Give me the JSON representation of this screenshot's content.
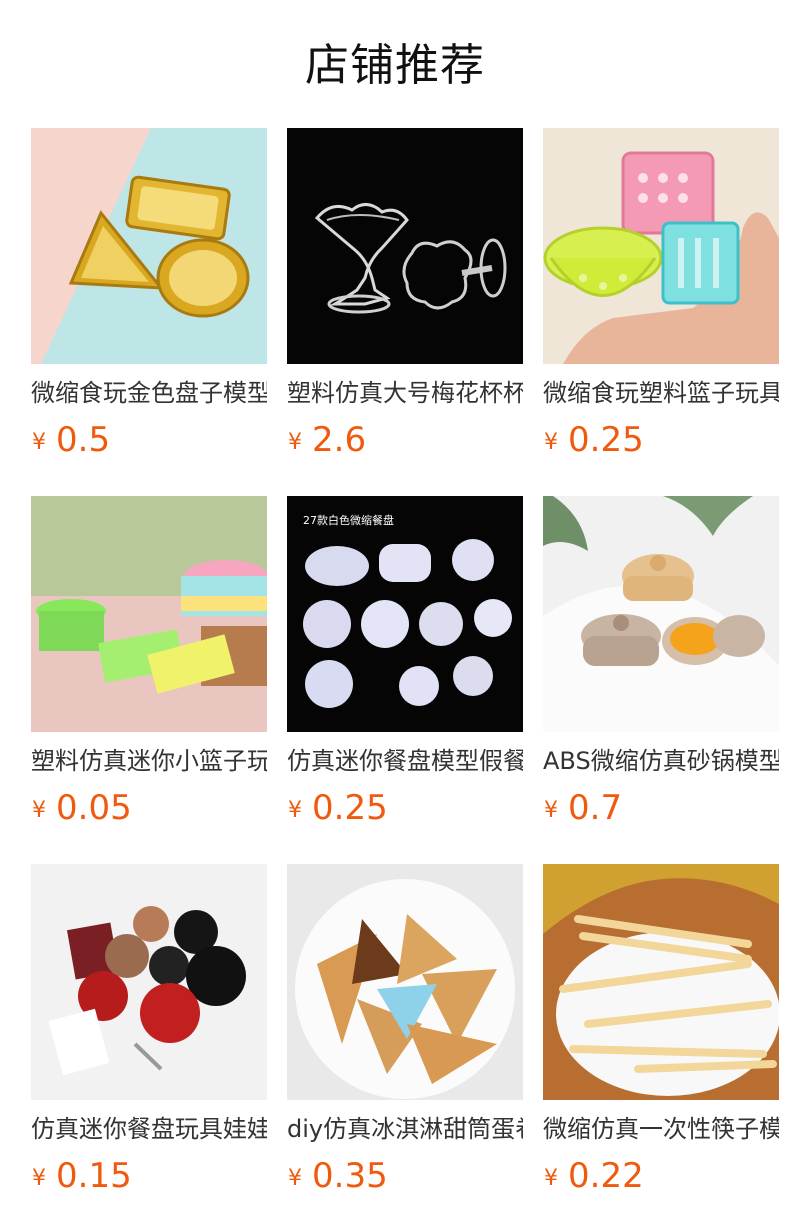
{
  "section": {
    "title": "店铺推荐"
  },
  "products": [
    {
      "name": "微缩食玩金色盘子模型",
      "currency": "¥",
      "price": "0.5",
      "image": "gold-plates-image"
    },
    {
      "name": "塑料仿真大号梅花杯杯",
      "currency": "¥",
      "price": "2.6",
      "image": "plastic-cup-image"
    },
    {
      "name": "微缩食玩塑料篮子玩具",
      "currency": "¥",
      "price": "0.25",
      "image": "plastic-baskets-image"
    },
    {
      "name": "塑料仿真迷你小篮子玩",
      "currency": "¥",
      "price": "0.05",
      "image": "mini-baskets-image"
    },
    {
      "name": "仿真迷你餐盘模型假餐",
      "currency": "¥",
      "price": "0.25",
      "image": "mini-plates-image",
      "image_label": "27款白色微缩餐盘"
    },
    {
      "name": "ABS微缩仿真砂锅模型",
      "currency": "¥",
      "price": "0.7",
      "image": "clay-pots-image"
    },
    {
      "name": "仿真迷你餐盘玩具娃娃",
      "currency": "¥",
      "price": "0.15",
      "image": "mini-tableware-image"
    },
    {
      "name": "diy仿真冰淇淋甜筒蛋卷",
      "currency": "¥",
      "price": "0.35",
      "image": "ice-cream-cones-image"
    },
    {
      "name": "微缩仿真一次性筷子模",
      "currency": "¥",
      "price": "0.22",
      "image": "chopsticks-image"
    }
  ]
}
